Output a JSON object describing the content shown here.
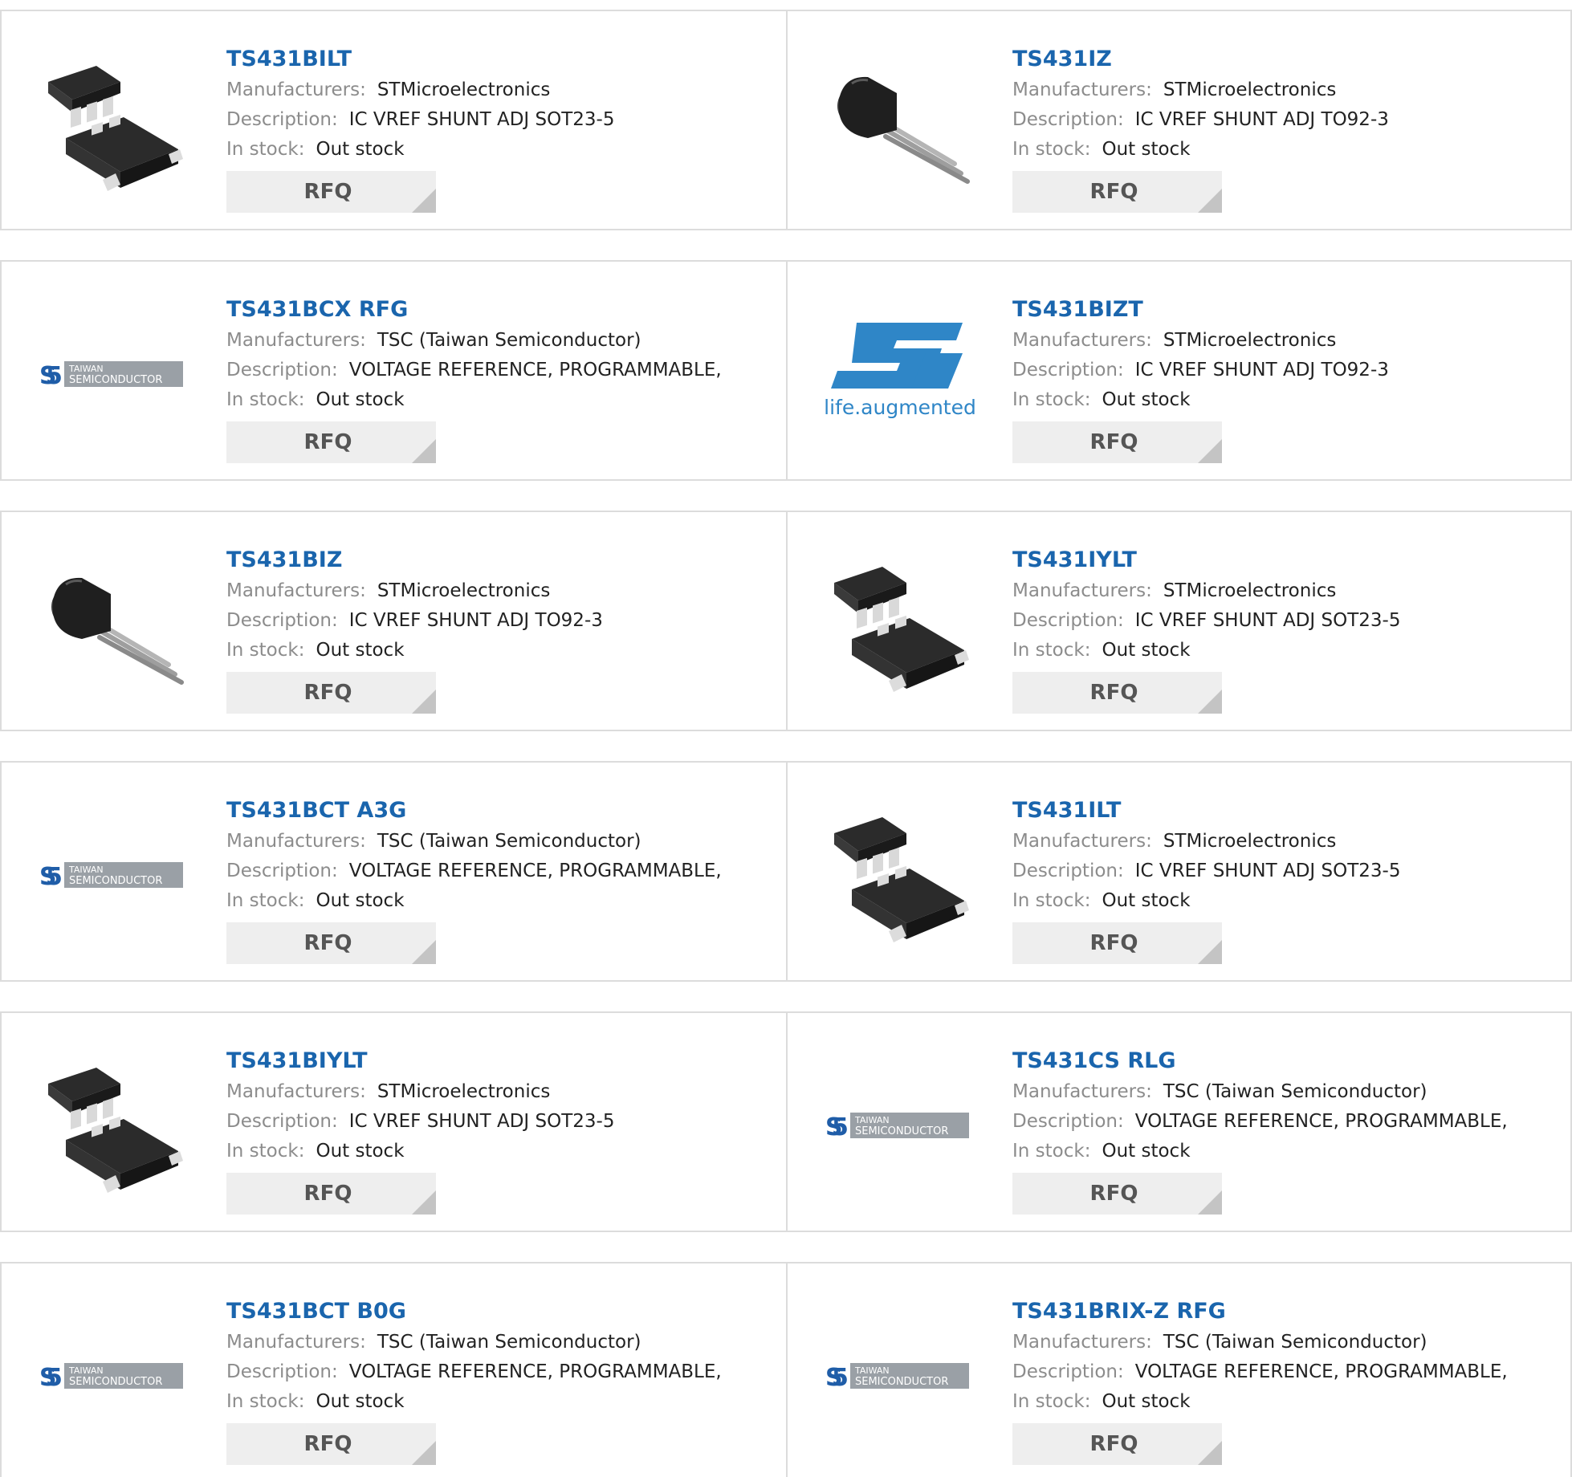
{
  "labels": {
    "manufacturers": "Manufacturers:",
    "description": "Description:",
    "stock": "In stock:",
    "rfq": "RFQ"
  },
  "logos": {
    "taiwan_line1": "TAIWAN",
    "taiwan_line2": "SEMICONDUCTOR",
    "st_tagline": "life.augmented"
  },
  "colors": {
    "part_link": "#1a65ad",
    "st_blue": "#2f86c7",
    "rfq_bg": "#eeeeee"
  },
  "products": [
    {
      "part": "TS431BILT",
      "manufacturer": "STMicroelectronics",
      "description": "IC VREF SHUNT ADJ SOT23-5",
      "stock": "Out stock",
      "image": "sot23-5-package"
    },
    {
      "part": "TS431IZ",
      "manufacturer": "STMicroelectronics",
      "description": "IC VREF SHUNT ADJ TO92-3",
      "stock": "Out stock",
      "image": "to92-package"
    },
    {
      "part": "TS431BCX RFG",
      "manufacturer": "TSC (Taiwan Semiconductor)",
      "description": "VOLTAGE REFERENCE, PROGRAMMABLE,",
      "stock": "Out stock",
      "image": "taiwan-semiconductor-logo"
    },
    {
      "part": "TS431BIZT",
      "manufacturer": "STMicroelectronics",
      "description": "IC VREF SHUNT ADJ TO92-3",
      "stock": "Out stock",
      "image": "st-logo"
    },
    {
      "part": "TS431BIZ",
      "manufacturer": "STMicroelectronics",
      "description": "IC VREF SHUNT ADJ TO92-3",
      "stock": "Out stock",
      "image": "to92-package"
    },
    {
      "part": "TS431IYLT",
      "manufacturer": "STMicroelectronics",
      "description": "IC VREF SHUNT ADJ SOT23-5",
      "stock": "Out stock",
      "image": "sot23-5-package"
    },
    {
      "part": "TS431BCT A3G",
      "manufacturer": "TSC (Taiwan Semiconductor)",
      "description": "VOLTAGE REFERENCE, PROGRAMMABLE,",
      "stock": "Out stock",
      "image": "taiwan-semiconductor-logo"
    },
    {
      "part": "TS431ILT",
      "manufacturer": "STMicroelectronics",
      "description": "IC VREF SHUNT ADJ SOT23-5",
      "stock": "Out stock",
      "image": "sot23-5-package"
    },
    {
      "part": "TS431BIYLT",
      "manufacturer": "STMicroelectronics",
      "description": "IC VREF SHUNT ADJ SOT23-5",
      "stock": "Out stock",
      "image": "sot23-5-package"
    },
    {
      "part": "TS431CS RLG",
      "manufacturer": "TSC (Taiwan Semiconductor)",
      "description": "VOLTAGE REFERENCE, PROGRAMMABLE,",
      "stock": "Out stock",
      "image": "taiwan-semiconductor-logo"
    },
    {
      "part": "TS431BCT B0G",
      "manufacturer": "TSC (Taiwan Semiconductor)",
      "description": "VOLTAGE REFERENCE, PROGRAMMABLE,",
      "stock": "Out stock",
      "image": "taiwan-semiconductor-logo"
    },
    {
      "part": "TS431BRIX-Z RFG",
      "manufacturer": "TSC (Taiwan Semiconductor)",
      "description": "VOLTAGE REFERENCE, PROGRAMMABLE,",
      "stock": "Out stock",
      "image": "taiwan-semiconductor-logo"
    }
  ]
}
